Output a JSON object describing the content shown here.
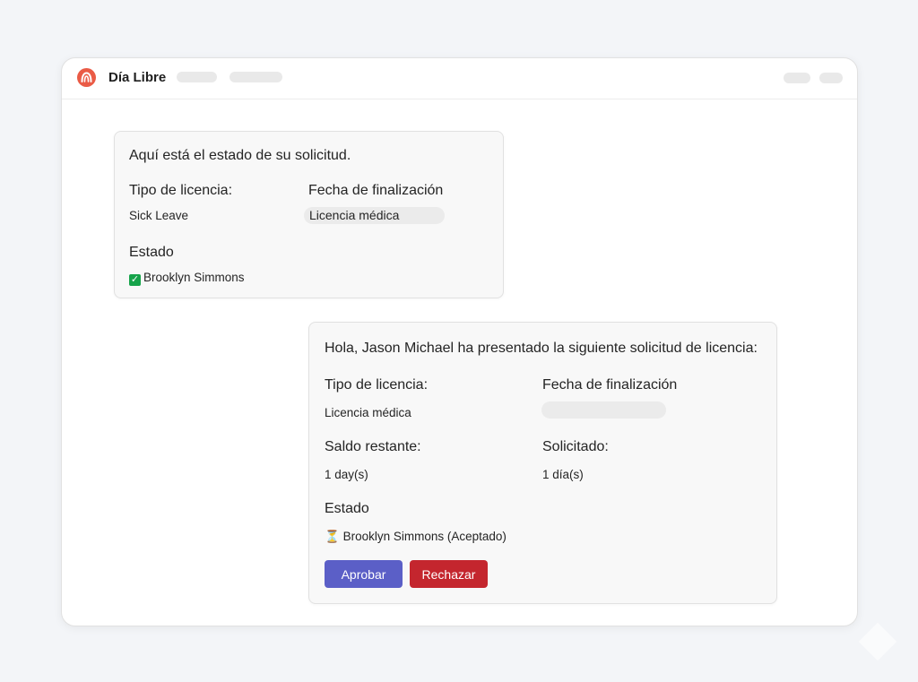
{
  "app": {
    "title": "Día Libre",
    "brand_color": "#ea5b46"
  },
  "status_card": {
    "intro": "Aquí está el estado de su solicitud.",
    "leave_type_label": "Tipo de licencia:",
    "leave_type_value": "Sick Leave",
    "end_date_label": "Fecha de finalización",
    "end_date_value": "Licencia médica",
    "status_label": "Estado",
    "status_icon": "check-mark-icon",
    "status_value": "Brooklyn Simmons"
  },
  "request_card": {
    "intro": "Hola, Jason Michael ha presentado la siguiente solicitud de licencia:",
    "leave_type_label": "Tipo de licencia:",
    "leave_type_value": "Licencia médica",
    "end_date_label": "Fecha de finalización",
    "end_date_value": "",
    "balance_label": "Saldo restante:",
    "balance_value": "1 day(s)",
    "requested_label": "Solicitado:",
    "requested_value": "1 día(s)",
    "status_label": "Estado",
    "status_icon": "hourglass-icon",
    "status_value": "Brooklyn Simmons (Aceptado)",
    "approve_label": "Aprobar",
    "reject_label": "Rechazar",
    "approve_color": "#5b5fc7",
    "reject_color": "#c4262e"
  }
}
